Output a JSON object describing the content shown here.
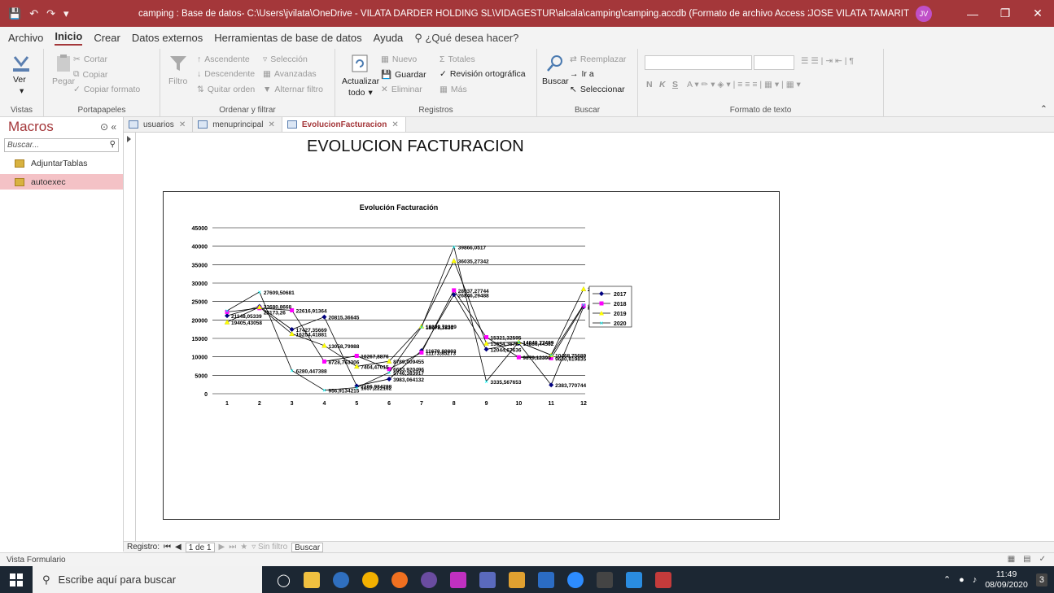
{
  "titlebar": {
    "title": "camping : Base de datos- C:\\Users\\jvilata\\OneDrive - VILATA DARDER HOLDING SL\\VIDAGESTUR\\alcala\\camping\\camping.accdb (Formato de archivo Access 2007 - 2016)  -  Access",
    "user": "JOSE VILATA TAMARIT",
    "initials": "JV"
  },
  "menu": {
    "items": [
      "Archivo",
      "Inicio",
      "Crear",
      "Datos externos",
      "Herramientas de base de datos",
      "Ayuda"
    ],
    "help_search": "¿Qué desea hacer?"
  },
  "ribbon": {
    "ver": "Ver",
    "vistas": "Vistas",
    "pegar": "Pegar",
    "cortar": "Cortar",
    "copiar": "Copiar",
    "copiar_formato": "Copiar formato",
    "portapapeles": "Portapapeles",
    "filtro": "Filtro",
    "ascendente": "Ascendente",
    "descendente": "Descendente",
    "quitar_orden": "Quitar orden",
    "seleccion": "Selección",
    "avanzadas": "Avanzadas",
    "alternar_filtro": "Alternar filtro",
    "ordenar_filtrar": "Ordenar y filtrar",
    "actualizar": "Actualizar",
    "todo": "todo",
    "nuevo": "Nuevo",
    "guardar": "Guardar",
    "eliminar": "Eliminar",
    "totales": "Totales",
    "revision": "Revisión ortográfica",
    "mas": "Más",
    "registros": "Registros",
    "buscar": "Buscar",
    "reemplazar": "Reemplazar",
    "ir_a": "Ir a",
    "seleccionar": "Seleccionar",
    "buscar_grp": "Buscar",
    "formato_texto": "Formato de texto",
    "bold": "N",
    "italic": "K",
    "underline": "S"
  },
  "nav": {
    "title": "Macros",
    "search_placeholder": "Buscar...",
    "items": [
      "AdjuntarTablas",
      "autoexec"
    ]
  },
  "tabs": [
    {
      "label": "usuarios"
    },
    {
      "label": "menuprincipal"
    },
    {
      "label": "EvolucionFacturacion"
    }
  ],
  "form": {
    "title": "EVOLUCION FACTURACION"
  },
  "record_nav": {
    "registro": "Registro:",
    "position": "1 de 1",
    "sin_filtro": "Sin filtro",
    "buscar": "Buscar"
  },
  "status": {
    "left": "Vista Formulario"
  },
  "taskbar": {
    "search": "Escribe aquí para buscar",
    "time": "11:49",
    "date": "08/09/2020",
    "notif": "3"
  },
  "colors": {
    "accent": "#a4373a",
    "s2017": "#000080",
    "s2018": "#ff00ff",
    "s2019": "#ffff00",
    "s2020": "#00ffff"
  },
  "chart_data": {
    "type": "line",
    "title": "Evolución Facturación",
    "xlabel": "",
    "ylabel": "",
    "categories": [
      "1",
      "2",
      "3",
      "4",
      "5",
      "6",
      "7",
      "8",
      "9",
      "10",
      "11",
      "12"
    ],
    "ylim": [
      0,
      45000
    ],
    "yticks": [
      "0",
      "5000",
      "10000",
      "15000",
      "20000",
      "25000",
      "30000",
      "35000",
      "40000",
      "45000"
    ],
    "grid": true,
    "legend": "right",
    "series": [
      {
        "name": "2017",
        "values": [
          21148.05339,
          23680.8668,
          17427.35669,
          20815.36645,
          2106.984298,
          3983.064132,
          11679.89893,
          26846.29488,
          12044.67636,
          13686.44562,
          2383.770744,
          23524.51432
        ]
      },
      {
        "name": "2018",
        "values": [
          22173.26,
          23200,
          22616.91364,
          8728.763306,
          10267.8876,
          6683.920496,
          11173.85273,
          28037.27744,
          15321.32595,
          9879.12399,
          9630.619835,
          23854.5
        ]
      },
      {
        "name": "2019",
        "values": [
          19405.43058,
          23500,
          16254.41881,
          13058.79988,
          7404.47015,
          8789.009455,
          18299.72339,
          36035.27342,
          13654.3678,
          14040.77499,
          10468.75689,
          28402.03739
        ]
      },
      {
        "name": "2020",
        "values": [
          22500,
          27609.50681,
          6280.447388,
          956.9134215,
          1657.222162,
          5746.383917,
          18078.3839,
          39866.0517,
          3335.567653,
          14040.77499,
          10468.75689,
          24133
        ]
      }
    ],
    "data_labels": [
      {
        "text": "21148,05339",
        "x": "1",
        "y": 21148
      },
      {
        "text": "19405,43058",
        "x": "1",
        "y": 19405
      },
      {
        "text": "27609,50681",
        "x": "2",
        "y": 27609
      },
      {
        "text": "23680,8668",
        "x": "2",
        "y": 23680
      },
      {
        "text": "22173,26",
        "x": "2",
        "y": 22173
      },
      {
        "text": "22616,91364",
        "x": "3",
        "y": 22616
      },
      {
        "text": "17427,35669",
        "x": "3",
        "y": 17427
      },
      {
        "text": "16254,41881",
        "x": "3",
        "y": 16254
      },
      {
        "text": "6280,447388",
        "x": "3",
        "y": 6280
      },
      {
        "text": "20815,36645",
        "x": "4",
        "y": 20815
      },
      {
        "text": "13058,79988",
        "x": "4",
        "y": 13058
      },
      {
        "text": "8728,763306",
        "x": "4",
        "y": 8728
      },
      {
        "text": "956,9134215",
        "x": "4",
        "y": 956
      },
      {
        "text": "10267,8876",
        "x": "5",
        "y": 10267
      },
      {
        "text": "7404,47015",
        "x": "5",
        "y": 7404
      },
      {
        "text": "2106,984298",
        "x": "5",
        "y": 2106
      },
      {
        "text": "1657,222162",
        "x": "5",
        "y": 1657
      },
      {
        "text": "8789,009455",
        "x": "6",
        "y": 8789
      },
      {
        "text": "6683,920496",
        "x": "6",
        "y": 6683
      },
      {
        "text": "5746,383917",
        "x": "6",
        "y": 5746
      },
      {
        "text": "3983,064132",
        "x": "6",
        "y": 3983
      },
      {
        "text": "18299,72339",
        "x": "7",
        "y": 18299
      },
      {
        "text": "18078,3839",
        "x": "7",
        "y": 18078
      },
      {
        "text": "11679,89893",
        "x": "7",
        "y": 11679
      },
      {
        "text": "11173,85273",
        "x": "7",
        "y": 11173
      },
      {
        "text": "39866,0517",
        "x": "8",
        "y": 39866
      },
      {
        "text": "36035,27342",
        "x": "8",
        "y": 36035
      },
      {
        "text": "28037,27744",
        "x": "8",
        "y": 28037
      },
      {
        "text": "26846,29488",
        "x": "8",
        "y": 26846
      },
      {
        "text": "15321,32595",
        "x": "9",
        "y": 15321
      },
      {
        "text": "13654,3678",
        "x": "9",
        "y": 13654
      },
      {
        "text": "12044,67636",
        "x": "9",
        "y": 12044
      },
      {
        "text": "3335,567653",
        "x": "9",
        "y": 3335
      },
      {
        "text": "14040,77499",
        "x": "10",
        "y": 14040
      },
      {
        "text": "13686,44562",
        "x": "10",
        "y": 13686
      },
      {
        "text": "9879,12399",
        "x": "10",
        "y": 9879
      },
      {
        "text": "10468,75689",
        "x": "11",
        "y": 10468
      },
      {
        "text": "9630,619835",
        "x": "11",
        "y": 9630
      },
      {
        "text": "2383,770744",
        "x": "11",
        "y": 2383
      },
      {
        "text": "28402,03739",
        "x": "12",
        "y": 28402
      },
      {
        "text": "23854,5",
        "x": "12",
        "y": 23854
      },
      {
        "text": "23524,51432",
        "x": "12",
        "y": 23524
      }
    ]
  }
}
